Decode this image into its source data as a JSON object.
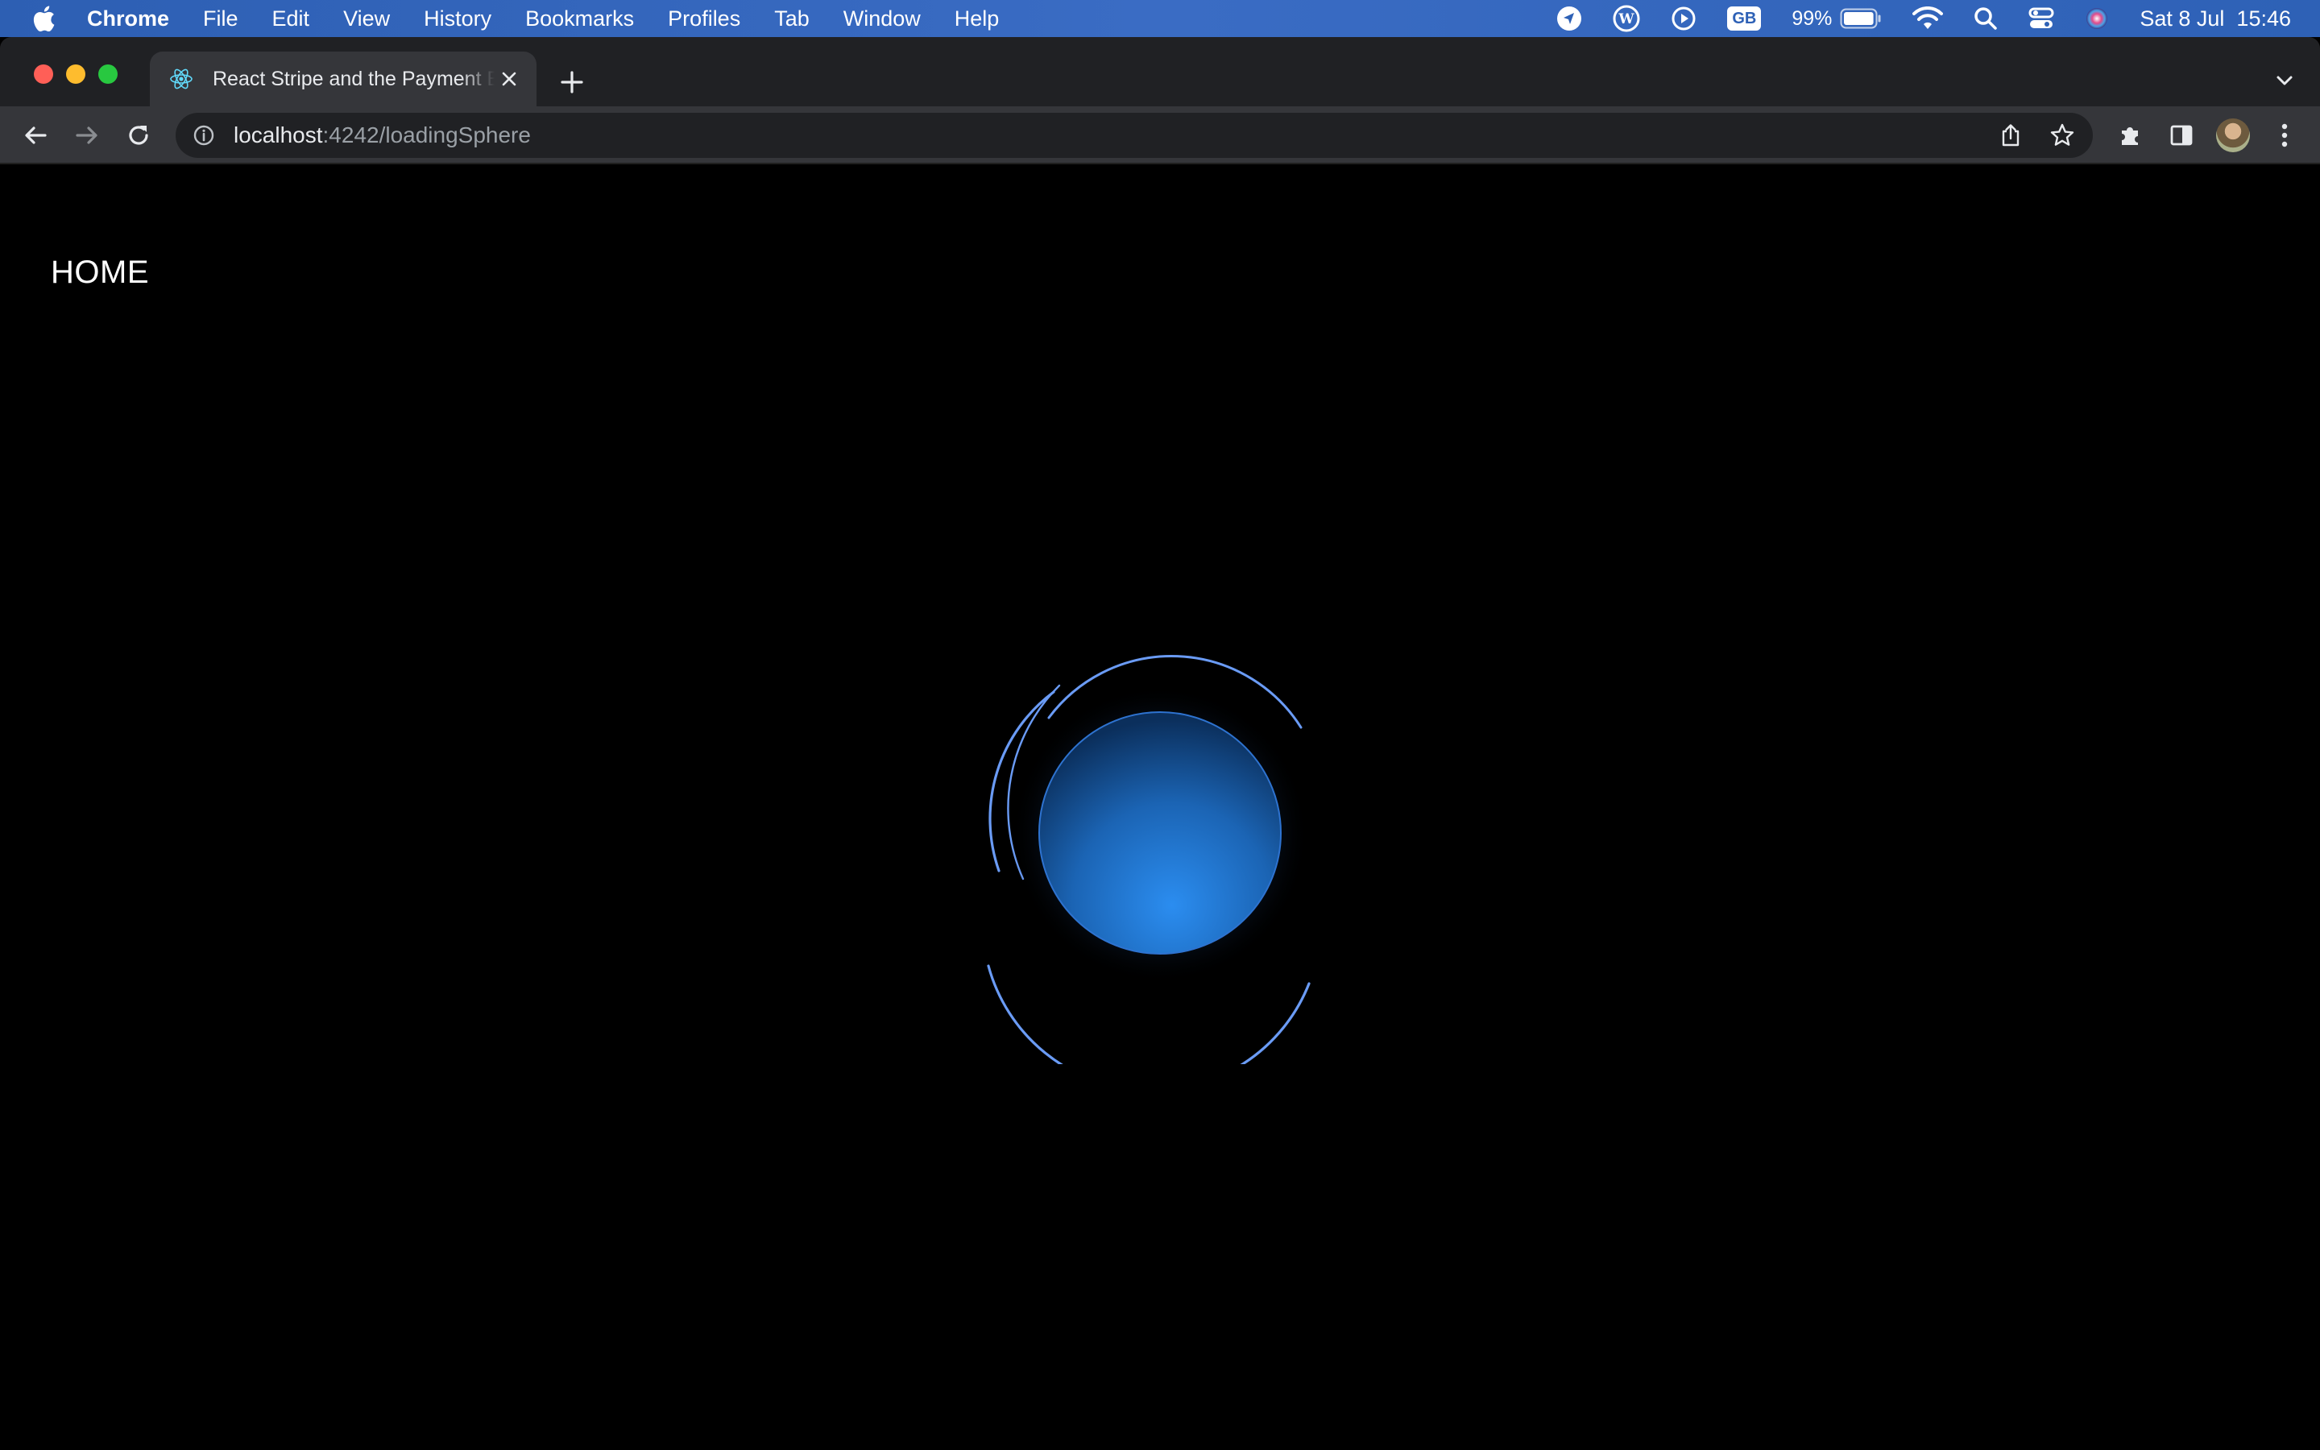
{
  "menubar": {
    "app_name": "Chrome",
    "menus": [
      "File",
      "Edit",
      "View",
      "History",
      "Bookmarks",
      "Profiles",
      "Tab",
      "Window",
      "Help"
    ],
    "status": {
      "input_source": "GB",
      "battery_percent": "99%",
      "battery_level": 0.99,
      "datetime": "Sat 8 Jul  15:46"
    }
  },
  "browser": {
    "tab": {
      "title": "React Stripe and the Payment Element",
      "favicon": "react-icon"
    },
    "address": {
      "host": "localhost",
      "rest": ":4242/loadingSphere"
    }
  },
  "page": {
    "nav_link": "HOME",
    "loader": {
      "name": "loading-sphere",
      "sphere_color": "#2b8df0",
      "ring_color": "#6a9bf5"
    }
  },
  "colors": {
    "menubar": "#3468c0",
    "chrome_dark": "#202124",
    "chrome_toolbar": "#35363a",
    "page_background": "#000000"
  }
}
